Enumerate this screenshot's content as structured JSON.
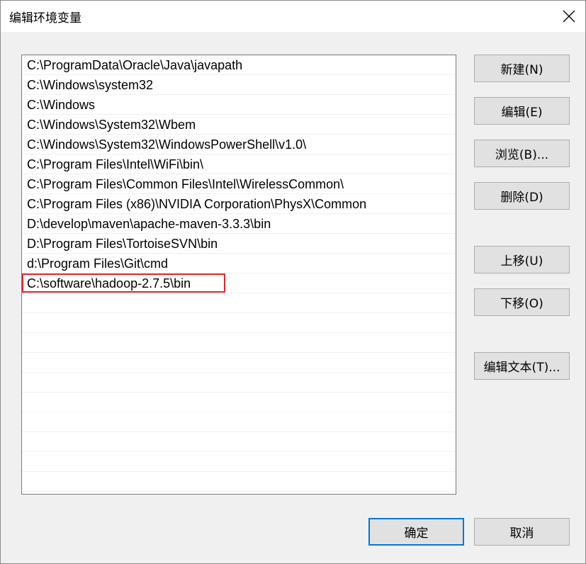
{
  "window": {
    "title": "编辑环境变量"
  },
  "list": {
    "items": [
      "C:\\ProgramData\\Oracle\\Java\\javapath",
      "C:\\Windows\\system32",
      "C:\\Windows",
      "C:\\Windows\\System32\\Wbem",
      "C:\\Windows\\System32\\WindowsPowerShell\\v1.0\\",
      "C:\\Program Files\\Intel\\WiFi\\bin\\",
      "C:\\Program Files\\Common Files\\Intel\\WirelessCommon\\",
      "C:\\Program Files (x86)\\NVIDIA Corporation\\PhysX\\Common",
      "D:\\develop\\maven\\apache-maven-3.3.3\\bin",
      "D:\\Program Files\\TortoiseSVN\\bin",
      "d:\\Program Files\\Git\\cmd",
      "C:\\software\\hadoop-2.7.5\\bin",
      "",
      "",
      "",
      "",
      "",
      "",
      "",
      "",
      "",
      ""
    ]
  },
  "buttons": {
    "new": "新建(N)",
    "edit": "编辑(E)",
    "browse": "浏览(B)...",
    "delete": "删除(D)",
    "move_up": "上移(U)",
    "move_down": "下移(O)",
    "edit_text": "编辑文本(T)...",
    "ok": "确定",
    "cancel": "取消"
  },
  "colors": {
    "highlight_border": "#e0292d",
    "primary_border": "#0078d7"
  }
}
